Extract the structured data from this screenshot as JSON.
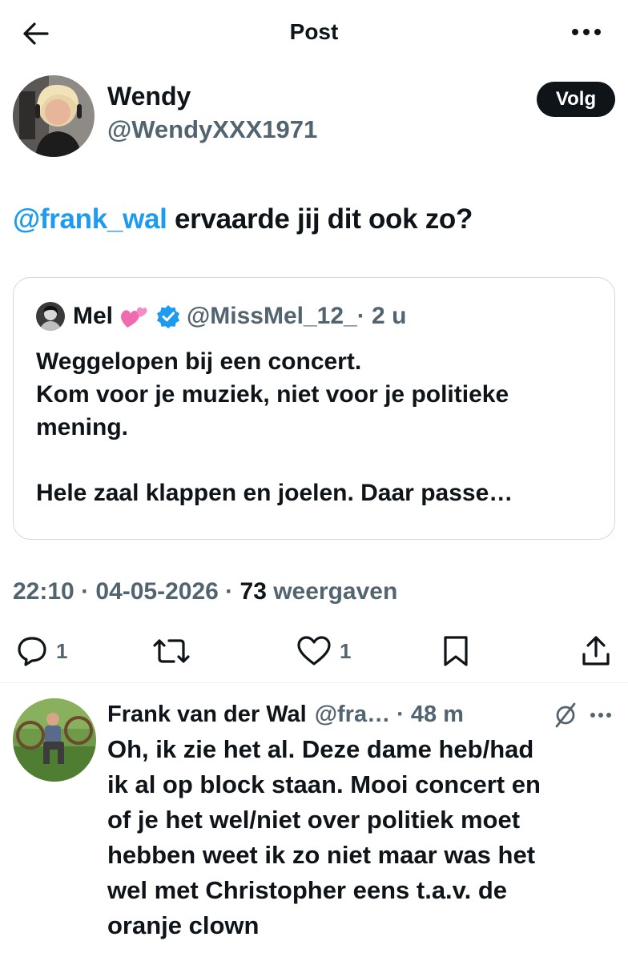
{
  "header": {
    "title": "Post"
  },
  "post": {
    "author_name": "Wendy",
    "author_handle": "@WendyXXX1971",
    "follow_label": "Volg",
    "mention": "@frank_wal",
    "text": " ervaarde jij dit ook zo?",
    "quote": {
      "name": "Mel",
      "handle": "@MissMel_12_",
      "time": " · 2 u",
      "lines": [
        "Weggelopen bij een concert.",
        "Kom voor je muziek, niet voor je politieke",
        "mening.",
        "",
        "Hele zaal klappen en joelen. Daar passe…"
      ]
    },
    "time": "22:10 · 04-05-2026 · ",
    "views_count": "73",
    "views_label": " weergaven",
    "actions": {
      "replies": "1",
      "likes": "1"
    }
  },
  "reply": {
    "author_name": "Frank van der Wal",
    "author_handle": "@fra… · 48 m",
    "lines": [
      "Oh, ik zie het al. Deze dame heb/had",
      "ik al op block staan. Mooi concert en",
      "of je het wel/niet over politiek moet",
      "hebben weet ik zo niet maar was het",
      "wel met Christopher eens t.a.v. de",
      "oranje clown"
    ]
  },
  "colors": {
    "accent": "#1d9bf0",
    "text": "#0f1419",
    "muted": "#536471",
    "border": "#cfd9de"
  },
  "icons": {
    "back": "arrow-left-icon",
    "more": "more-horizontal-icon",
    "reply": "speech-bubble-icon",
    "repost": "repost-icon",
    "like": "heart-icon",
    "bookmark": "bookmark-icon",
    "share": "share-icon",
    "grok": "grok-icon",
    "verified": "verified-badge-icon",
    "emoji": "two-hearts-emoji"
  }
}
